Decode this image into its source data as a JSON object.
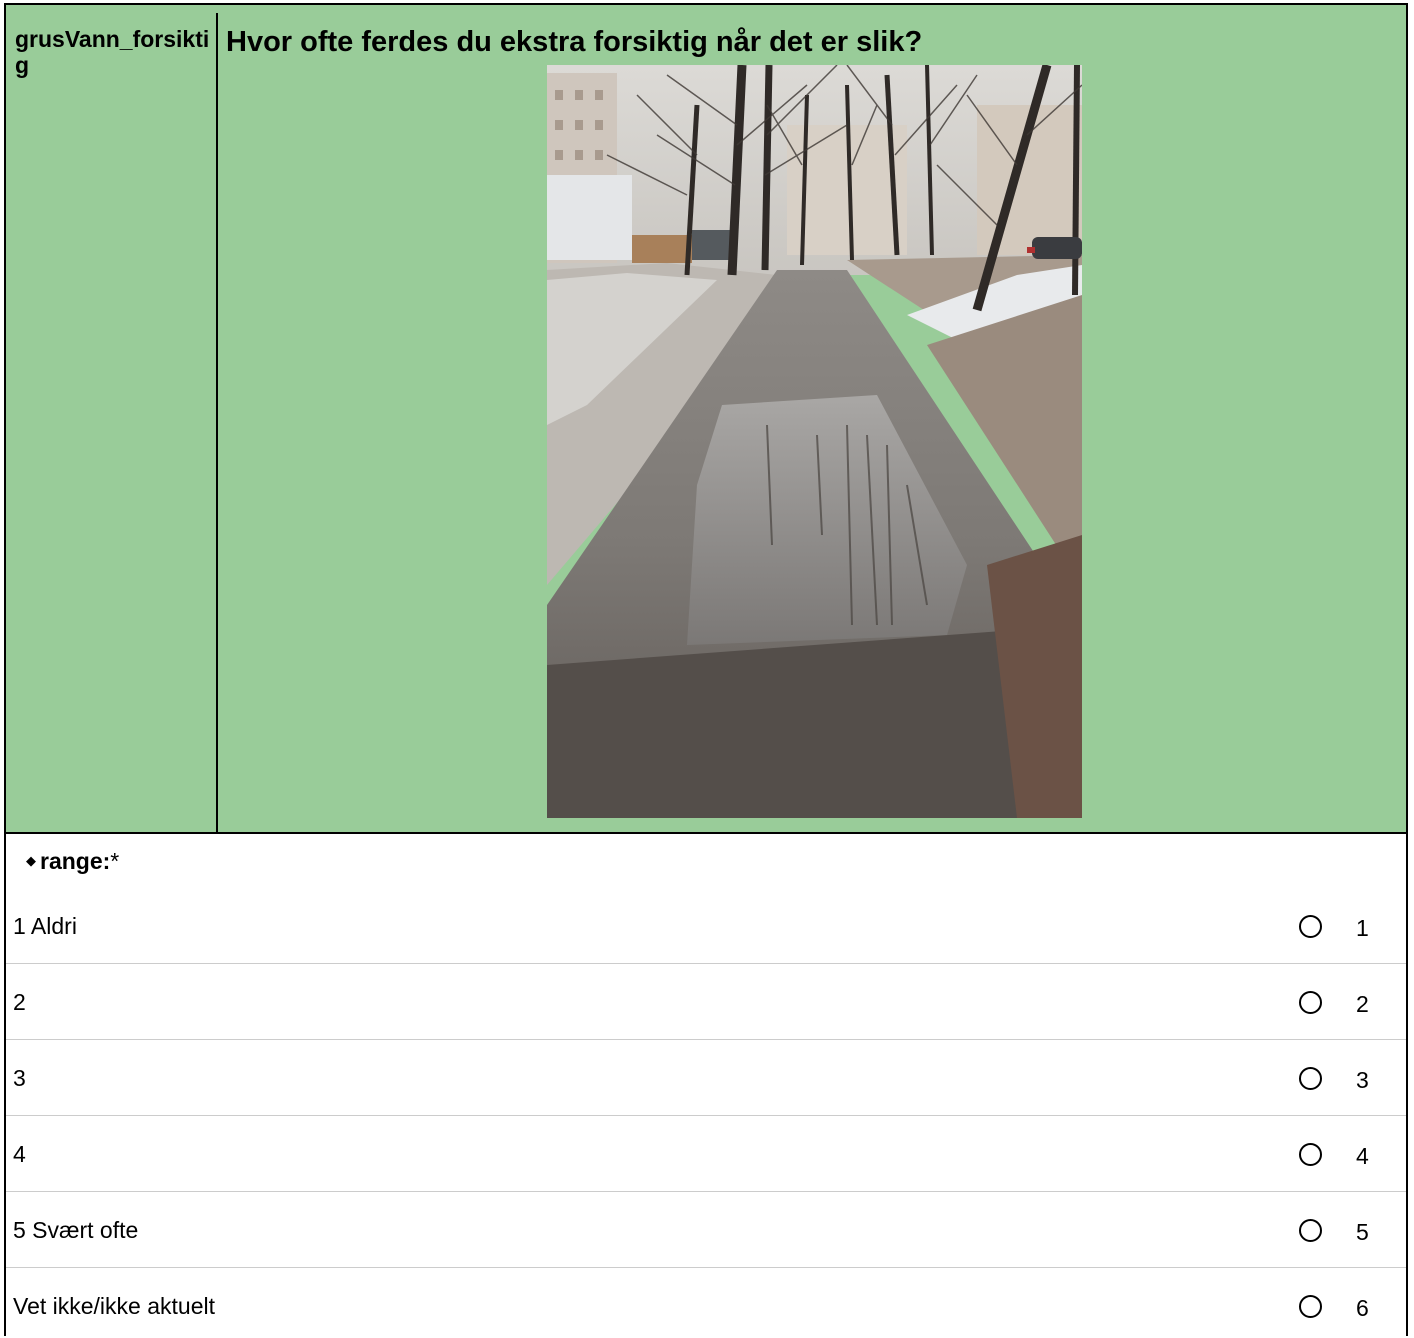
{
  "question": {
    "variable_name": "grusVann_forsiktig",
    "text": "Hvor ofte ferdes du ekstra forsiktig når det er slik?"
  },
  "range": {
    "label": "range:",
    "required_marker": "*"
  },
  "options": [
    {
      "label": "1 Aldri",
      "value": "1"
    },
    {
      "label": "2",
      "value": "2"
    },
    {
      "label": "3",
      "value": "3"
    },
    {
      "label": "4",
      "value": "4"
    },
    {
      "label": "5 Svært ofte",
      "value": "5"
    },
    {
      "label": "Vet ikke/ikke aktuelt",
      "value": "6"
    }
  ],
  "colors": {
    "header_background": "#99cc99",
    "row_separator": "#cccccc"
  }
}
